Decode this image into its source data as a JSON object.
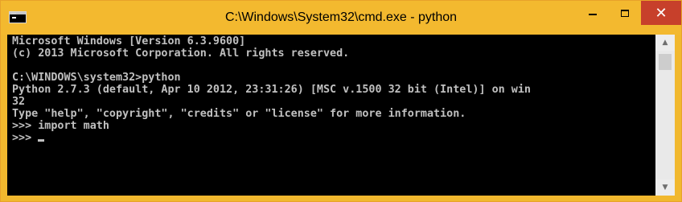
{
  "window": {
    "title": "C:\\Windows\\System32\\cmd.exe - python",
    "accent_color": "#f3b92f",
    "close_color": "#c7402b",
    "app_icon": "console-icon"
  },
  "controls": {
    "minimize_icon": "minimize-icon",
    "maximize_icon": "maximize-icon",
    "close_glyph": "✕"
  },
  "console": {
    "lines": [
      "Microsoft Windows [Version 6.3.9600]",
      "(c) 2013 Microsoft Corporation. All rights reserved.",
      "",
      "C:\\WINDOWS\\system32>python",
      "Python 2.7.3 (default, Apr 10 2012, 23:31:26) [MSC v.1500 32 bit (Intel)] on win",
      "32",
      "Type \"help\", \"copyright\", \"credits\" or \"license\" for more information.",
      ">>> import math",
      ">>> "
    ],
    "text_color": "#c0c0c0",
    "background": "#000000"
  },
  "scrollbar": {
    "up_glyph": "▲",
    "down_glyph": "▼"
  }
}
